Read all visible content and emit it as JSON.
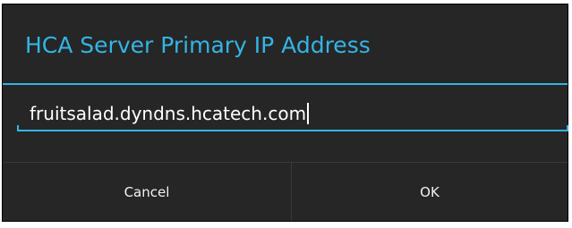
{
  "dialog": {
    "title": "HCA Server Primary IP Address",
    "input": {
      "value": "fruitsalad.dyndns.hcatech.com"
    },
    "buttons": {
      "cancel_label": "Cancel",
      "ok_label": "OK"
    }
  },
  "colors": {
    "accent": "#33b5e5",
    "background": "#262626",
    "text": "#ffffff"
  }
}
